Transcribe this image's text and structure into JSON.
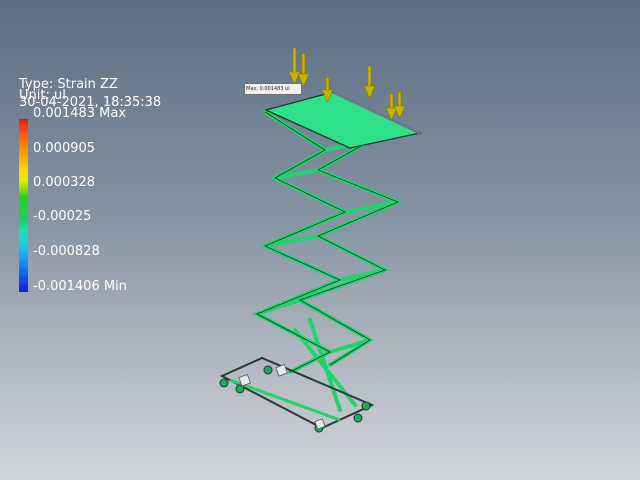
{
  "header": {
    "type_text": "Type: Strain ZZ",
    "unit_text": "Unit: ul",
    "date_text": "30-04-2021, 18:35:38"
  },
  "legend": {
    "labels": [
      "0.001483 Max",
      "0.000905",
      "0.000328",
      "-0.00025",
      "-0.000828",
      "-0.001406 Min"
    ],
    "colors": [
      "#e8191c",
      "#ff9f00",
      "#d9ef00",
      "#2ccf1f",
      "#1fe0b0",
      "#1588f0",
      "#1a1ad8"
    ]
  },
  "probe": {
    "text": "Max: 0.001483 ul"
  },
  "model": {
    "frame_color": "#1fd46a",
    "load_arrow_color": "#c8b400",
    "outline_color": "#1a3a26"
  },
  "icons": {
    "load_arrow": "load-arrow-icon",
    "wheel": "caster-wheel-icon",
    "constraint": "fixed-constraint-icon"
  }
}
